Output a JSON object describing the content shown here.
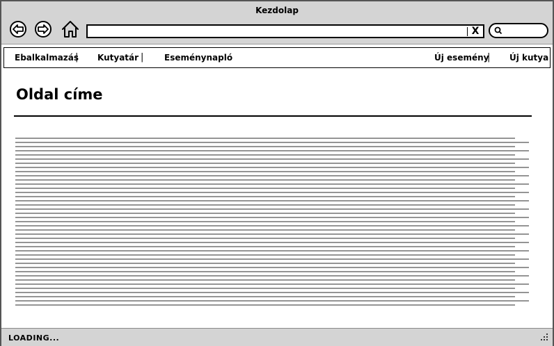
{
  "window": {
    "title": "Kezdolap"
  },
  "toolbar": {
    "back_icon": "back-arrow-icon",
    "forward_icon": "forward-arrow-icon",
    "home_icon": "home-icon",
    "address_value": "",
    "clear_label": "X",
    "search_icon": "search-icon",
    "search_value": ""
  },
  "menu": {
    "left": [
      {
        "label": "Ebalkalmazás"
      },
      {
        "label": "Kutyatár"
      },
      {
        "label": "Eseménynapló"
      }
    ],
    "right": [
      {
        "label": "Új esemény"
      },
      {
        "label": "Új kutya"
      }
    ],
    "separator": "|"
  },
  "page": {
    "title": "Oldal címe"
  },
  "status": {
    "text": "LOADING..."
  }
}
